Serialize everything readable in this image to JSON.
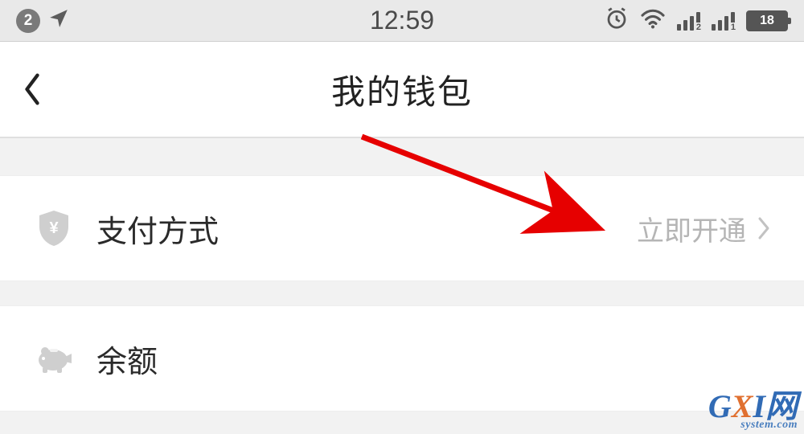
{
  "statusbar": {
    "notification_count": "2",
    "time": "12:59",
    "battery": "18",
    "sim1_label": "2",
    "sim2_label": "1"
  },
  "nav": {
    "title": "我的钱包"
  },
  "rows": {
    "payment": {
      "label": "支付方式",
      "action": "立即开通"
    },
    "balance": {
      "label": "余额"
    }
  },
  "watermark": {
    "brand_g": "G",
    "brand_x": "X",
    "brand_i": "I",
    "brand_net": "网",
    "sub": "system.com"
  }
}
